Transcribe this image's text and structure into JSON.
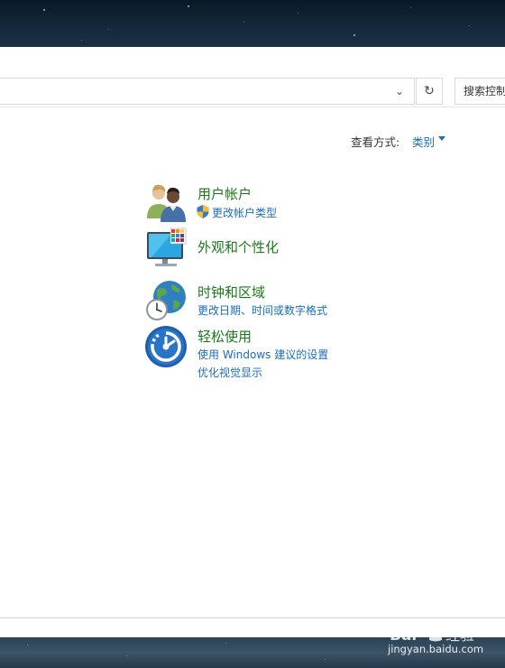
{
  "toolbar": {
    "refresh_glyph": "↻",
    "dropdown_glyph": "⌄",
    "search_placeholder": "搜索控制"
  },
  "view": {
    "label": "查看方式:",
    "value": "类别"
  },
  "categories": [
    {
      "title": "用户帐户",
      "icon": "users-icon",
      "links": [
        "更改帐户类型"
      ]
    },
    {
      "title": "外观和个性化",
      "icon": "appearance-icon",
      "links": []
    },
    {
      "title": "时钟和区域",
      "icon": "clock-globe-icon",
      "links": [
        "更改日期、时间或数字格式"
      ]
    },
    {
      "title": "轻松使用",
      "icon": "ease-of-access-icon",
      "links": [
        "使用 Windows 建议的设置",
        "优化视觉显示"
      ]
    }
  ],
  "watermark": {
    "brand": "Bai经验",
    "url": "jingyan.baidu.com"
  },
  "colors": {
    "category_title": "#1a7a1a",
    "link": "#1a6dbf"
  }
}
